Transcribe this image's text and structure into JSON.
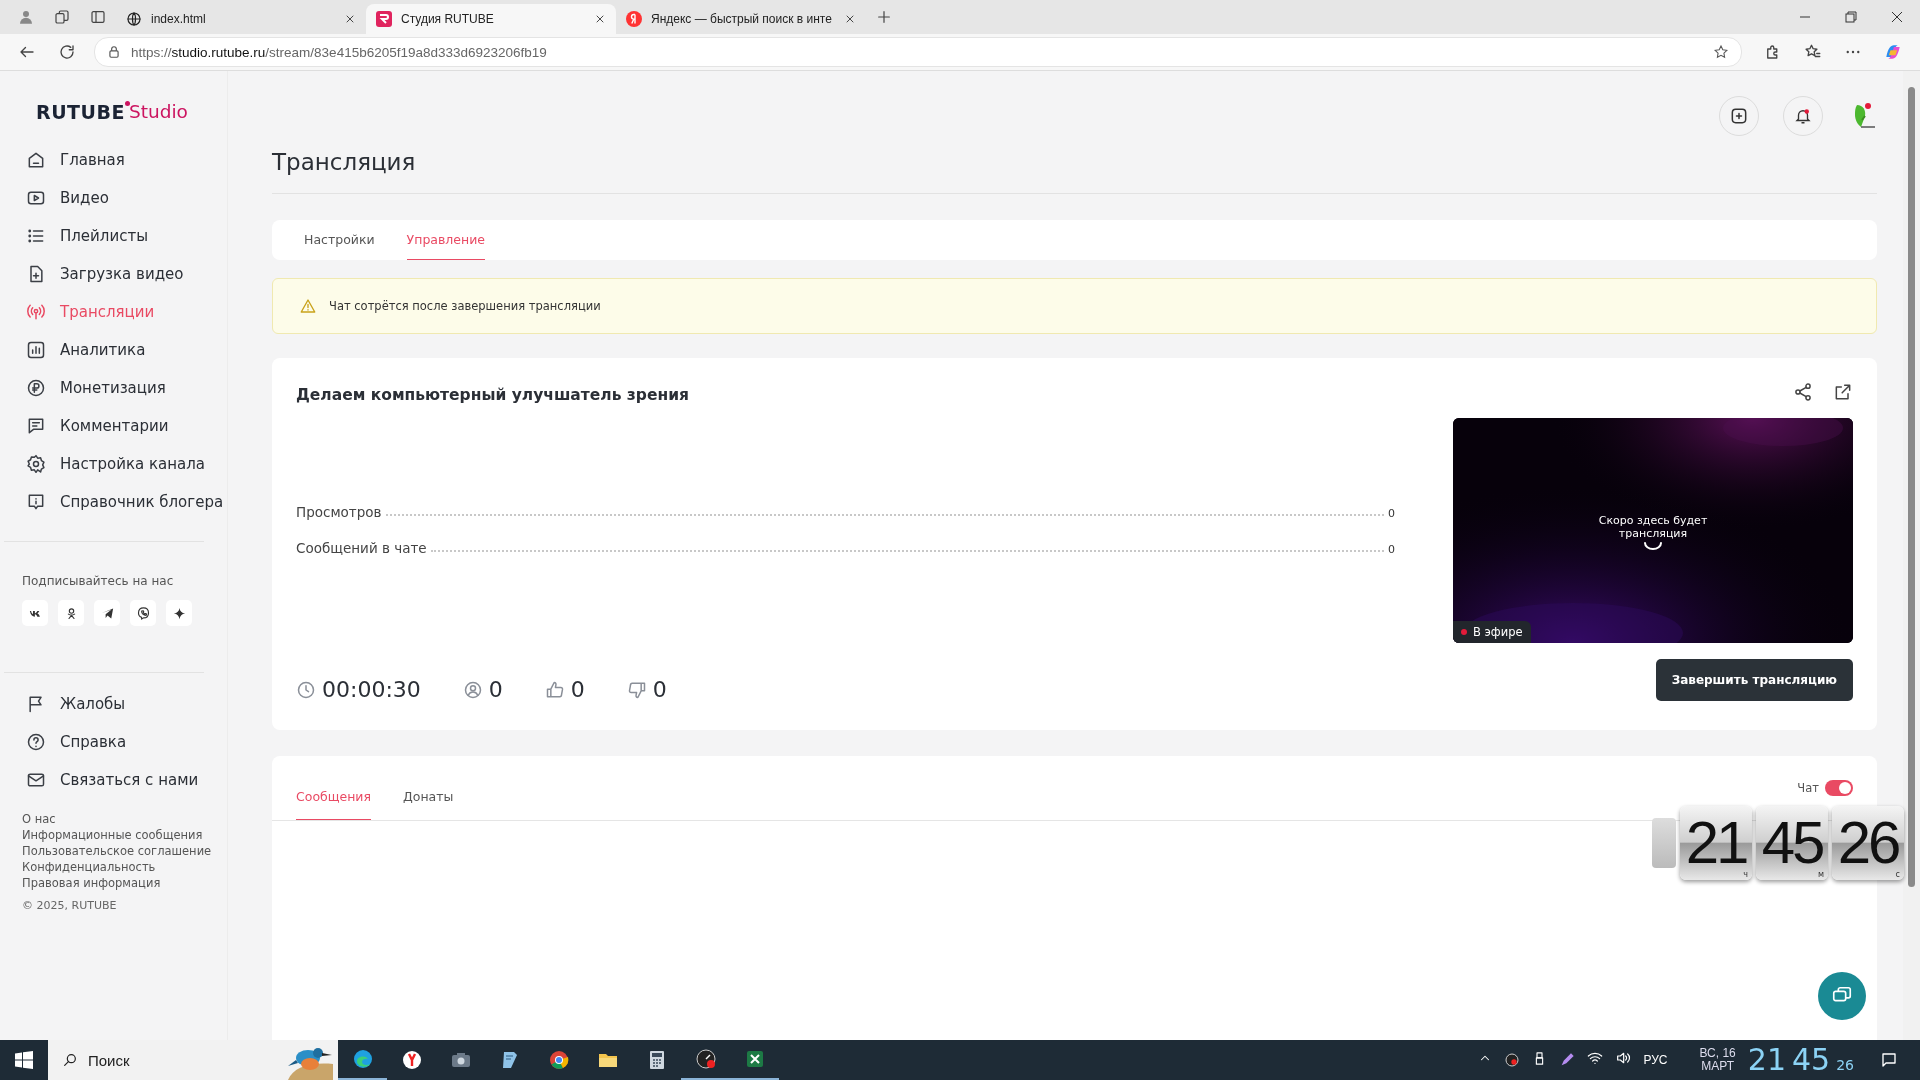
{
  "browser": {
    "tabs": [
      {
        "title": "index.html",
        "selected": false
      },
      {
        "title": "Студия RUTUBE",
        "selected": true
      },
      {
        "title": "Яндекс — быстрый поиск в инте",
        "selected": false
      }
    ],
    "address": {
      "scheme": "https://",
      "host": "studio.rutube.ru",
      "path": "/stream/83e415b6205f19a8d333d6923206fb19"
    }
  },
  "logo": {
    "brand": "RUTUBE",
    "product": "Studio"
  },
  "nav": [
    {
      "label": "Главная",
      "selected": false
    },
    {
      "label": "Видео",
      "selected": false
    },
    {
      "label": "Плейлисты",
      "selected": false
    },
    {
      "label": "Загрузка видео",
      "selected": false
    },
    {
      "label": "Трансляции",
      "selected": true
    },
    {
      "label": "Аналитика",
      "selected": false
    },
    {
      "label": "Монетизация",
      "selected": false
    },
    {
      "label": "Комментарии",
      "selected": false
    },
    {
      "label": "Настройка канала",
      "selected": false
    },
    {
      "label": "Справочник блогера",
      "selected": false
    }
  ],
  "social_title": "Подписывайтесь на нас",
  "secondary_nav": [
    {
      "label": "Жалобы"
    },
    {
      "label": "Справка"
    },
    {
      "label": "Связаться с нами"
    }
  ],
  "footer_links": [
    "О нас",
    "Информационные сообщения",
    "Пользовательское соглашение",
    "Конфиденциальность",
    "Правовая информация"
  ],
  "copyright": "© 2025, RUTUBE",
  "page_title": "Трансляция",
  "tabs": [
    {
      "label": "Настройки",
      "selected": false
    },
    {
      "label": "Управление",
      "selected": true
    }
  ],
  "notice": "Чат сотрётся после завершения трансляции",
  "stream": {
    "title": "Делаем компьютерный улучшатель зрения",
    "stats": [
      {
        "label": "Просмотров",
        "value": "0"
      },
      {
        "label": "Сообщений в чате",
        "value": "0"
      }
    ],
    "timer": "00:00:30",
    "viewers": "0",
    "likes": "0",
    "dislikes": "0",
    "preview_message": "Скоро здесь будет трансляция",
    "live_label": "В эфире",
    "end_button": "Завершить трансляцию"
  },
  "chat": {
    "tabs": [
      {
        "label": "Сообщения",
        "selected": true
      },
      {
        "label": "Донаты",
        "selected": false
      }
    ],
    "toggle_label": "Чат",
    "enabled": true
  },
  "clock_widget": {
    "hours": "21",
    "minutes": "45",
    "seconds": "26",
    "hours_unit": "ч",
    "minutes_unit": "м",
    "seconds_unit": "с"
  },
  "taskbar": {
    "search": "Поиск",
    "language": "РУС",
    "date_day": "ВС, 16",
    "date_month": "МАРТ",
    "hours": "21",
    "minutes": "45",
    "seconds": "26"
  }
}
